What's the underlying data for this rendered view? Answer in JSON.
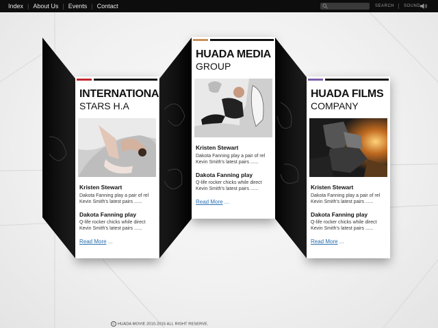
{
  "nav": {
    "items": [
      "Index",
      "About Us",
      "Events",
      "Contact"
    ]
  },
  "header": {
    "search_label": "SEARCH",
    "sound_label": "SOUND"
  },
  "cards": [
    {
      "title": "INTERNATIONA",
      "subtitle": "STARS H.A",
      "accent": "#c0272d",
      "items": [
        {
          "title": "Kristen Stewart",
          "text": "Dakota Fanning play a pair of rel Kevin Smith's latest pairs ......"
        },
        {
          "title": "Dakota Fanning play",
          "text": "Q-life rocker chicks while direct Kevin Smith's latest pairs ......"
        }
      ],
      "more_label": "Read More",
      "more_suffix": " ..."
    },
    {
      "title": "HUADA MEDIA",
      "subtitle": "GROUP",
      "accent": "#c8905a",
      "items": [
        {
          "title": "Kristen Stewart",
          "text": "Dakota Fanning play a pair of rel Kevin Smith's latest pairs ......"
        },
        {
          "title": "Dakota Fanning play",
          "text": "Q-life rocker chicks while direct Kevin Smith's latest pairs ......"
        }
      ],
      "more_label": "Read More",
      "more_suffix": " ..."
    },
    {
      "title": "HUADA FILMS",
      "subtitle": "COMPANY",
      "accent": "#7b5ea8",
      "items": [
        {
          "title": "Kristen Stewart",
          "text": "Dakota Fanning play a pair of rel Kevin Smith's latest pairs ......"
        },
        {
          "title": "Dakota Fanning play",
          "text": "Q-life rocker chicks while direct Kevin Smith's latest pairs ......"
        }
      ],
      "more_label": "Read More",
      "more_suffix": " ..."
    }
  ],
  "footer": {
    "copyright_symbol": "C",
    "text": "HUADA MOVIE 2010-2015 ALL RIGHT RESERVE."
  }
}
